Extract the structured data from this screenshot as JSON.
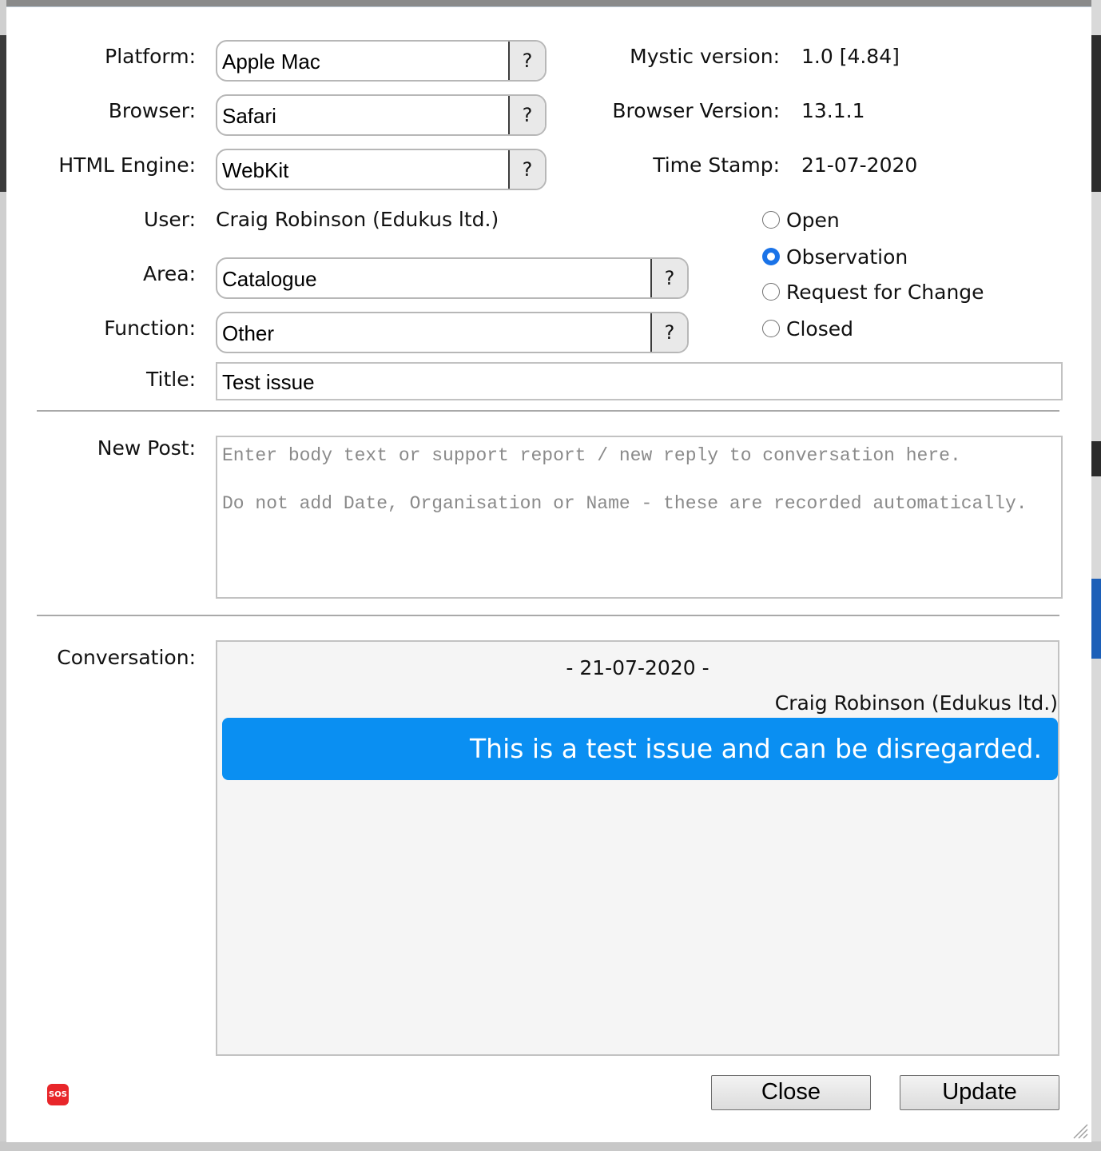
{
  "form": {
    "platform": {
      "label": "Platform:",
      "value": "Apple Mac",
      "help": "?"
    },
    "browser": {
      "label": "Browser:",
      "value": "Safari",
      "help": "?"
    },
    "html_engine": {
      "label": "HTML Engine:",
      "value": "WebKit",
      "help": "?"
    },
    "user": {
      "label": "User:",
      "value": "Craig Robinson (Edukus ltd.)"
    },
    "area": {
      "label": "Area:",
      "value": "Catalogue",
      "help": "?"
    },
    "function": {
      "label": "Function:",
      "value": "Other",
      "help": "?"
    },
    "title": {
      "label": "Title:",
      "value": "Test issue"
    }
  },
  "info": {
    "mystic_version": {
      "label": "Mystic version:",
      "value": "1.0 [4.84]"
    },
    "browser_version": {
      "label": "Browser Version:",
      "value": "13.1.1"
    },
    "time_stamp": {
      "label": "Time Stamp:",
      "value": "21-07-2020"
    }
  },
  "status": {
    "options": [
      "Open",
      "Observation",
      "Request for Change",
      "Closed"
    ],
    "selected": "Observation"
  },
  "new_post": {
    "label": "New Post:",
    "placeholder": "Enter body text or support report / new reply to conversation here.\n\nDo not add Date, Organisation or Name - these are recorded automatically."
  },
  "conversation": {
    "label": "Conversation:",
    "date": "- 21-07-2020 -",
    "author": "Craig Robinson (Edukus ltd.)",
    "message": "This is a test issue and can be disregarded."
  },
  "buttons": {
    "close": "Close",
    "update": "Update"
  },
  "sos": {
    "label": "SOS"
  },
  "colors": {
    "accent": "#1a73e8",
    "bubble": "#0a8ff2",
    "sos": "#e8262a"
  }
}
